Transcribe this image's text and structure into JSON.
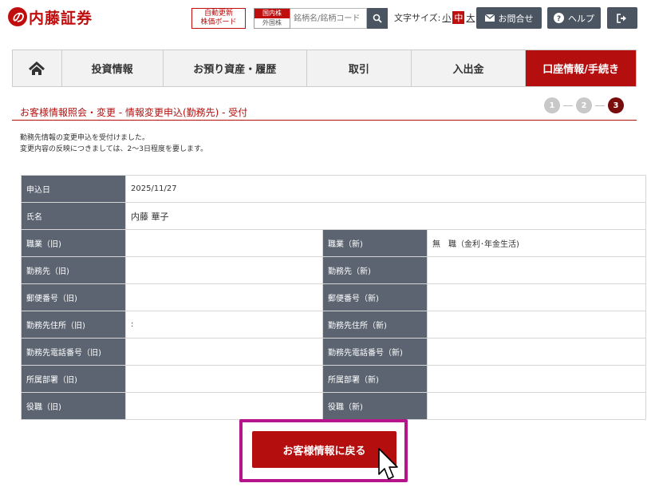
{
  "header": {
    "logo_mark": "の",
    "logo_text": "内藤証券",
    "board_label_1": "自動更新",
    "board_label_2": "株価ボード",
    "market_1": "国内株",
    "market_2": "外国株",
    "search_placeholder": "銘柄名/銘柄コード",
    "font_size_label": "文字サイズ:",
    "font_small": "小",
    "font_mid": "中",
    "font_large": "大",
    "contact_label": "お問合せ",
    "help_label": "ヘルプ"
  },
  "nav": {
    "items": [
      "投資情報",
      "お預り資産・履歴",
      "取引",
      "入出金",
      "口座情報/手続き"
    ],
    "active_index": 4
  },
  "page": {
    "title": "お客様情報照会・変更 - 情報変更申込(勤務先) - 受付",
    "steps": [
      "1",
      "2",
      "3"
    ],
    "active_step": 3,
    "message_1": "勤務先情報の変更申込を受付けました。",
    "message_2": "変更内容の反映につきましては、2〜3日程度を要します。"
  },
  "table": {
    "apply_date_label": "申込日",
    "apply_date": "2025/11/27",
    "name_label": "氏名",
    "name": "内藤 華子",
    "rows": [
      {
        "old_label": "職業（旧)",
        "old_value": "",
        "new_label": "職業（新)",
        "new_value": "無　職（金利･年金生活)"
      },
      {
        "old_label": "勤務先（旧)",
        "old_value": "",
        "new_label": "勤務先（新)",
        "new_value": ""
      },
      {
        "old_label": "郵便番号（旧)",
        "old_value": "",
        "new_label": "郵便番号（新)",
        "new_value": ""
      },
      {
        "old_label": "勤務先住所（旧)",
        "old_value": ":",
        "new_label": "勤務先住所（新)",
        "new_value": ""
      },
      {
        "old_label": "勤務先電話番号（旧)",
        "old_value": "",
        "new_label": "勤務先電話番号（新)",
        "new_value": ""
      },
      {
        "old_label": "所属部署（旧)",
        "old_value": "",
        "new_label": "所属部署（新)",
        "new_value": ""
      },
      {
        "old_label": "役職（旧)",
        "old_value": "",
        "new_label": "役職（新)",
        "new_value": ""
      }
    ]
  },
  "actions": {
    "back_label": "お客様情報に戻る"
  },
  "colors": {
    "brand_red": "#b50e0e",
    "label_bg": "#5b6470",
    "highlight": "#b5148b"
  }
}
